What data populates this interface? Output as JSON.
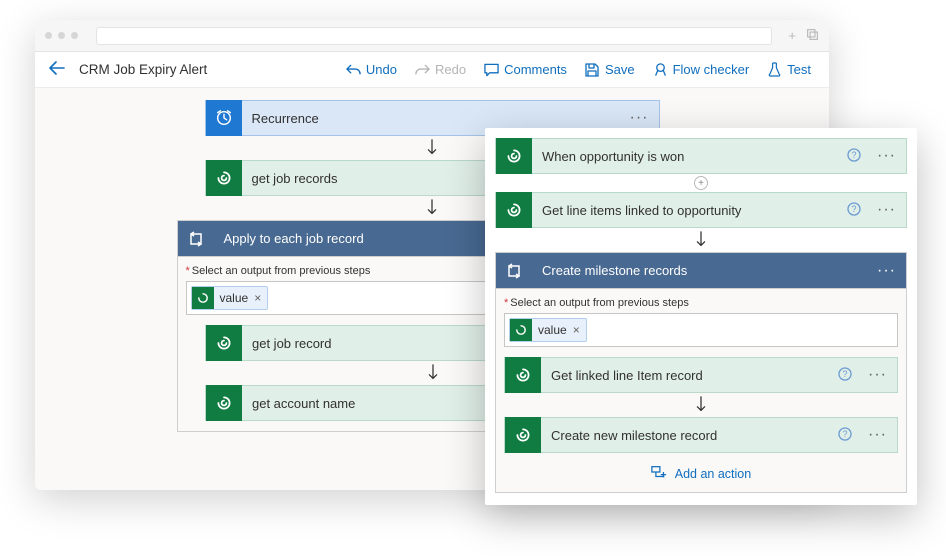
{
  "header": {
    "title": "CRM Job Expiry Alert"
  },
  "toolbar": {
    "undo": "Undo",
    "redo": "Redo",
    "comments": "Comments",
    "save": "Save",
    "flow_checker": "Flow checker",
    "test": "Test"
  },
  "flow1": {
    "recurrence": "Recurrence",
    "get_job_records": "get job records",
    "foreach_title": "Apply to each job record",
    "select_output_label": "Select an output from previous steps",
    "token_value": "value",
    "get_job_record": "get job record",
    "get_account_name": "get account name"
  },
  "flow2": {
    "when_opportunity_won": "When opportunity is won",
    "get_line_items": "Get line items linked to opportunity",
    "foreach_title": "Create milestone records",
    "select_output_label": "Select an output from previous steps",
    "token_value": "value",
    "get_linked_line_item": "Get linked line Item record",
    "create_new_milestone": "Create new milestone record",
    "add_action": "Add an action"
  }
}
